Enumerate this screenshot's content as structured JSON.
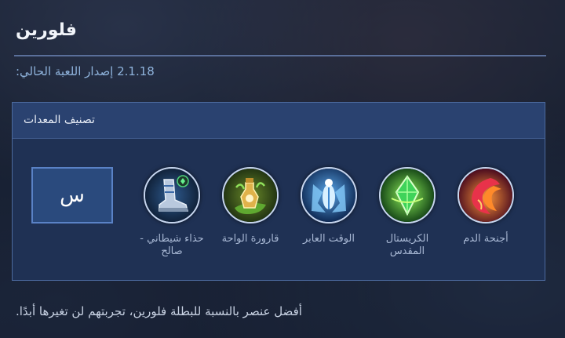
{
  "header": {
    "hero_name": "فلورين"
  },
  "version": {
    "text": "2.1.18 إصدار اللعبة الحالي:"
  },
  "panel": {
    "title": "تصنيف المعدات",
    "slot_button_label": "س",
    "items": [
      {
        "name": "أجنحة الدم",
        "icon": "blood-wings-icon"
      },
      {
        "name": "الكريستال المقدس",
        "icon": "holy-crystal-icon"
      },
      {
        "name": "الوقت العابر",
        "icon": "fleeting-time-icon"
      },
      {
        "name": "قارورة الواحة",
        "icon": "oasis-vial-icon"
      },
      {
        "name": "حذاء شيطاني - صالح",
        "icon": "demon-shoes-icon"
      }
    ]
  },
  "footer": {
    "text": "أفضل عنصر بالنسبة للبطلة فلورين، تجربتهم لن تغيرها أبدًا."
  },
  "colors": {
    "panel_bg": "#1f3154",
    "panel_border": "#4c6a9e",
    "accent": "#8fb3dc",
    "divider": "#5a6f9a"
  }
}
